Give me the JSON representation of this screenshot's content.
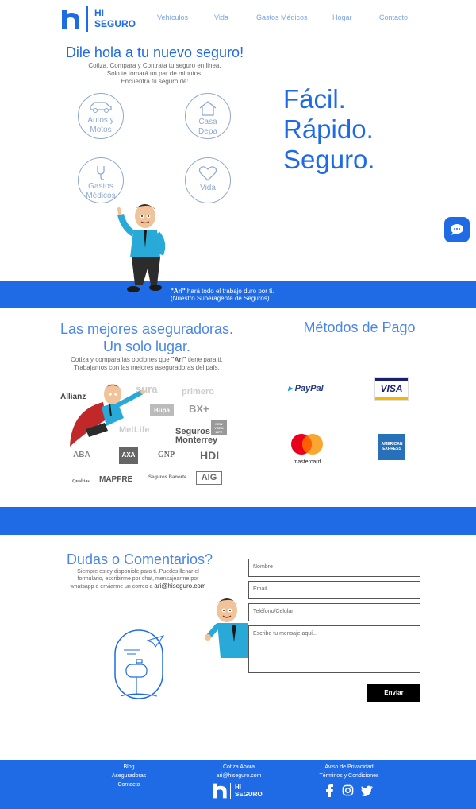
{
  "header": {
    "logo_line1": "HI",
    "logo_line2": "SEGURO",
    "nav": [
      "Vehículos",
      "Vida",
      "Gastos Médicos",
      "Hogar",
      "Contacto"
    ]
  },
  "hero": {
    "title": "Dile hola a tu nuevo seguro!",
    "sub1": "Cotiza, Compara y Contrata tu seguro en linea.",
    "sub2": "Solo te tomará un par de minutos.",
    "sub3": "Encuentra tu seguro de:",
    "options": [
      {
        "l1": "Autos y",
        "l2": "Motos",
        "icon": "car-icon"
      },
      {
        "l1": "Casa",
        "l2": "Depa",
        "icon": "house-icon"
      },
      {
        "l1": "Gastos",
        "l2": "Médicos",
        "icon": "stethoscope-icon"
      },
      {
        "l1": "Vida",
        "l2": "",
        "icon": "heart-icon"
      }
    ],
    "slogan1": "Fácil.",
    "slogan2": "Rápido.",
    "slogan3": "Seguro.",
    "band_bold": "\"Ari\"",
    "band_text": " hará todo el trabajo duro por ti.",
    "band_text2": "(Nuestro Superagente de Seguros)"
  },
  "insurers": {
    "title1": "Las mejores aseguradoras.",
    "title2": "Un solo lugar.",
    "desc1_a": "Cotiza y compara las opciones que ",
    "desc1_bold": "\"Ari\"",
    "desc1_b": " tiene para ti.",
    "desc2": "Trabajamos con las mejores aseguradoras del país.",
    "logos": [
      "Allianz",
      "sura",
      "primero",
      "Bupa",
      "BX+",
      "NEW YORK LIFE",
      "MetLife",
      "Seguros Monterrey",
      "ABA",
      "AXA",
      "GNP",
      "HDI",
      "Qualitas",
      "MAPFRE",
      "Seguros Banorte",
      "AIG"
    ]
  },
  "payments": {
    "title": "Métodos de Pago",
    "paypal": "PayPal",
    "visa": "VISA",
    "mastercard": "mastercard",
    "amex1": "AMERICAN",
    "amex2": "EXPRESS"
  },
  "contact": {
    "title": "Dudas o Comentarios?",
    "desc1": "Siempre estoy disponible para ti. Puedes llenar el",
    "desc2": "formulario, escribirme por chat, mensajearme por",
    "desc3": "whatsapp o enviarme un correo a ",
    "email": "ari@hiseguro.com",
    "name_ph": "Nombre",
    "email_ph": "Email",
    "phone_ph": "Teléfono/Celular",
    "msg_ph": "Escribe tu mensaje aquí...",
    "send": "Enviar"
  },
  "footer": {
    "col1": [
      "Blog",
      "Aseguradoras",
      "Contacto"
    ],
    "col2": [
      "Cotiza Ahora",
      "ari@hiseguro.com"
    ],
    "col3": [
      "Aviso de Privacidad",
      "Términos y Condiciones"
    ],
    "logo_line1": "HI",
    "logo_line2": "SEGURO"
  },
  "colors": {
    "brand": "#1f6be6",
    "text_light": "#8fa9cf"
  }
}
